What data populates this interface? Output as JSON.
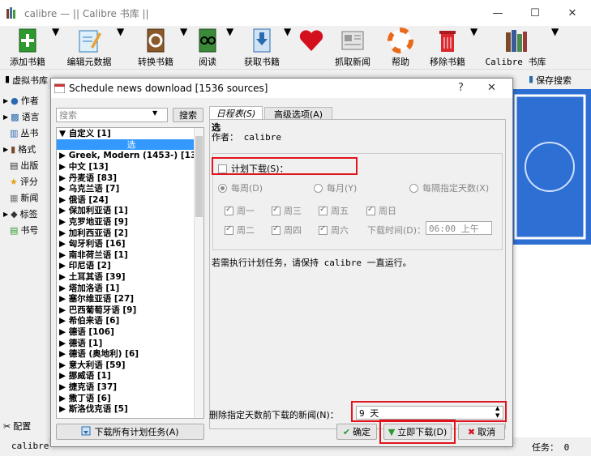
{
  "window": {
    "title": "calibre — || Calibre 书库 ||",
    "min": "—",
    "max": "☐",
    "close": "✕"
  },
  "toolbar": [
    {
      "label": "添加书籍",
      "icon": "add-book-icon"
    },
    {
      "label": "编辑元数据",
      "icon": "edit-metadata-icon"
    },
    {
      "label": "转换书籍",
      "icon": "convert-books-icon"
    },
    {
      "label": "阅读",
      "icon": "read-icon"
    },
    {
      "label": "获取书籍",
      "icon": "get-books-icon"
    },
    {
      "label": "",
      "icon": "heart-icon"
    },
    {
      "label": "抓取新闻",
      "icon": "fetch-news-icon"
    },
    {
      "label": "帮助",
      "icon": "help-icon"
    },
    {
      "label": "移除书籍",
      "icon": "remove-books-icon"
    },
    {
      "label": "Calibre 书库",
      "icon": "library-icon"
    }
  ],
  "searchbar": {
    "virtual_library": "虚拟书库",
    "saved_search": "保存搜索",
    "partial": "搜索"
  },
  "sidebar": [
    {
      "label": "作者",
      "icon": "author-icon"
    },
    {
      "label": "语言",
      "icon": "language-icon"
    },
    {
      "label": "丛书",
      "icon": "series-icon"
    },
    {
      "label": "格式",
      "icon": "format-icon"
    },
    {
      "label": "出版",
      "icon": "publisher-icon"
    },
    {
      "label": "评分",
      "icon": "rating-icon"
    },
    {
      "label": "新闻",
      "icon": "news-icon"
    },
    {
      "label": "标签",
      "icon": "tag-icon"
    },
    {
      "label": "书号",
      "icon": "identifier-icon"
    }
  ],
  "sidebar_config": "配置",
  "status": {
    "left": "calibre",
    "right": "任务：  0"
  },
  "dialog": {
    "title": "Schedule news download [1536 sources]",
    "help": "?",
    "close": "✕",
    "search_placeholder": "搜索",
    "search_btn": "搜索",
    "tree": [
      {
        "label": "▼ 自定义 [1]",
        "selected": false
      },
      {
        "label": "选",
        "selected": true
      },
      {
        "label": "▶ Greek, Modern (1453-) [13]",
        "selected": false
      },
      {
        "label": "▶ 中文 [13]",
        "selected": false
      },
      {
        "label": "▶ 丹麦语 [83]",
        "selected": false
      },
      {
        "label": "▶ 乌克兰语 [7]",
        "selected": false
      },
      {
        "label": "▶ 俄语 [24]",
        "selected": false
      },
      {
        "label": "▶ 保加利亚语 [1]",
        "selected": false
      },
      {
        "label": "▶ 克罗地亚语 [9]",
        "selected": false
      },
      {
        "label": "▶ 加利西亚语 [2]",
        "selected": false
      },
      {
        "label": "▶ 匈牙利语 [16]",
        "selected": false
      },
      {
        "label": "▶ 南非荷兰语 [1]",
        "selected": false
      },
      {
        "label": "▶ 印尼语 [2]",
        "selected": false
      },
      {
        "label": "▶ 土耳其语 [39]",
        "selected": false
      },
      {
        "label": "▶ 塔加洛语 [1]",
        "selected": false
      },
      {
        "label": "▶ 塞尔维亚语 [27]",
        "selected": false
      },
      {
        "label": "▶ 巴西葡萄牙语 [9]",
        "selected": false
      },
      {
        "label": "▶ 希伯来语 [6]",
        "selected": false
      },
      {
        "label": "▶ 德语 [106]",
        "selected": false
      },
      {
        "label": "▶ 德语 [1]",
        "selected": false
      },
      {
        "label": "▶ 德语 (奥地利) [6]",
        "selected": false
      },
      {
        "label": "▶ 意大利语 [59]",
        "selected": false
      },
      {
        "label": "▶ 挪威语 [1]",
        "selected": false
      },
      {
        "label": "▶ 捷克语 [37]",
        "selected": false
      },
      {
        "label": "▶ 撒丁语 [6]",
        "selected": false
      },
      {
        "label": "▶ 斯洛伐克语 [5]",
        "selected": false
      }
    ],
    "download_all": "下载所有计划任务(A)",
    "tabs": {
      "schedule": "日程表(S)",
      "advanced": "高级选项(A)"
    },
    "recipe_title": "选",
    "author": "作者： calibre",
    "schedule_checkbox": "计划下载(S)：",
    "radio_weekly": "每周(D)",
    "radio_monthly": "每月(Y)",
    "radio_interval": "每隔指定天数(X)",
    "days": [
      "周一",
      "周三",
      "周五",
      "周日",
      "周二",
      "周四",
      "周六"
    ],
    "download_time_label": "下载时间(D)：",
    "download_time": "06:00 上午",
    "note": "若需执行计划任务，请保持 calibre 一直运行。",
    "delete_label": "删除指定天数前下载的新闻(N)：",
    "delete_value": "9 天",
    "ok": "确定",
    "download_now": "立即下载(D)",
    "cancel": "取消"
  }
}
